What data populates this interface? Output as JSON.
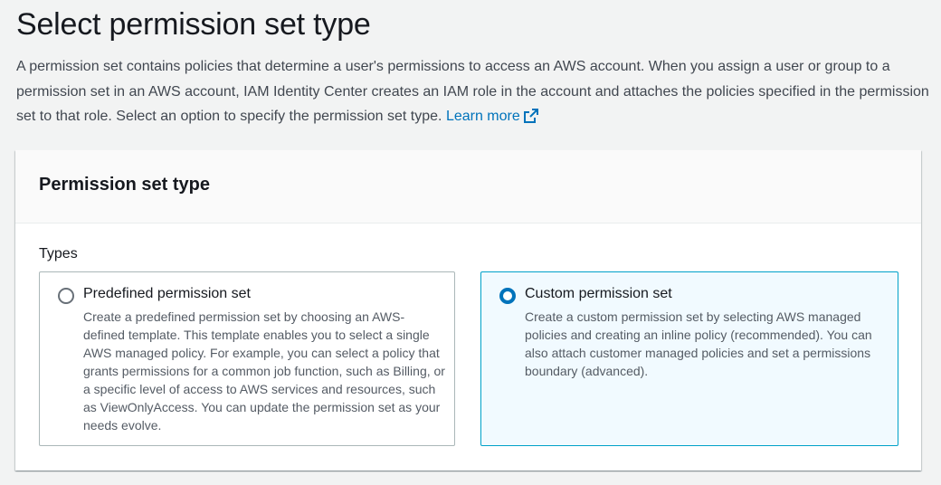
{
  "header": {
    "title": "Select permission set type",
    "description": "A permission set contains policies that determine a user's permissions to access an AWS account. When you assign a user or group to a permission set in an AWS account, IAM Identity Center creates an IAM role in the account and attaches the policies specified in the permission set to that role. Select an option to specify the permission set type.",
    "learn_more": "Learn more"
  },
  "panel": {
    "title": "Permission set type",
    "types_label": "Types",
    "options": [
      {
        "label": "Predefined permission set",
        "description": "Create a predefined permission set by choosing an AWS-defined template. This template enables you to select a single AWS managed policy. For example, you can select a policy that grants permissions for a common job function, such as Billing, or a specific level of access to AWS services and resources, such as ViewOnlyAccess. You can update the permission set as your needs evolve.",
        "selected": false
      },
      {
        "label": "Custom permission set",
        "description": "Create a custom permission set by selecting AWS managed policies and creating an inline policy (recommended). You can also attach customer managed policies and set a permissions boundary (advanced).",
        "selected": true
      }
    ]
  },
  "colors": {
    "accent": "#0073bb",
    "selected_bg": "#f1faff",
    "selected_border": "#00a1c9"
  }
}
